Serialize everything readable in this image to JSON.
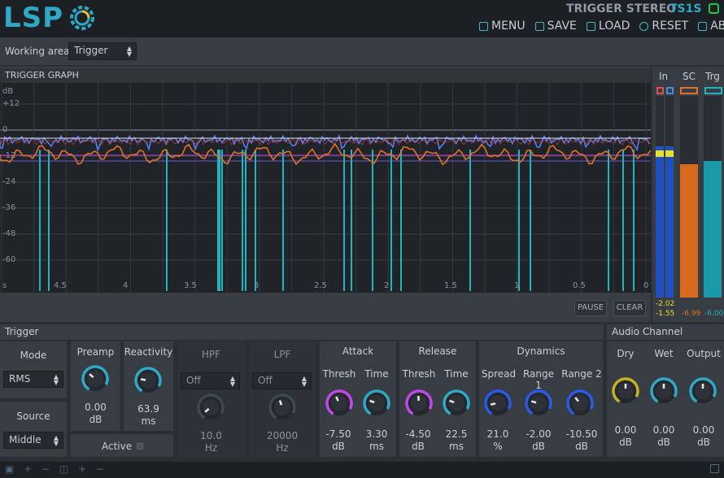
{
  "header": {
    "logo_text": "LSP",
    "plugin_name": "TRIGGER STEREO",
    "plugin_code": "TS1S",
    "menu": [
      {
        "label": "MENU",
        "icon": "menu-icon"
      },
      {
        "label": "SAVE",
        "icon": "save-icon"
      },
      {
        "label": "LOAD",
        "icon": "load-icon"
      },
      {
        "label": "RESET",
        "icon": "reset-icon"
      },
      {
        "label": "ABOUT",
        "icon": "about-icon"
      }
    ]
  },
  "working_area": {
    "label": "Working area",
    "value": "Trigger"
  },
  "graph": {
    "title": "TRIGGER GRAPH",
    "y_labels": [
      "dB",
      "+12",
      "0",
      "-12",
      "-24",
      "-36",
      "-48",
      "-60"
    ],
    "x_labels": [
      "s",
      "4.5",
      "4",
      "3.5",
      "3",
      "2.5",
      "2",
      "1.5",
      "1",
      "0.5",
      "0"
    ],
    "pause_label": "PAUSE",
    "clear_label": "CLEAR"
  },
  "meters": {
    "in": {
      "label": "In",
      "val1": "-2.02",
      "val2": "-1.55"
    },
    "sc": {
      "label": "SC",
      "val": "-6.99"
    },
    "trg": {
      "label": "Trg",
      "val": "-6.00"
    }
  },
  "trigger": {
    "title": "Trigger",
    "mode": {
      "label": "Mode",
      "value": "RMS"
    },
    "source": {
      "label": "Source",
      "value": "Middle"
    },
    "preamp": {
      "label": "Preamp",
      "value": "0.00",
      "unit": "dB"
    },
    "reactivity": {
      "label": "Reactivity",
      "value": "63.9",
      "unit": "ms"
    },
    "active": {
      "label": "Active"
    },
    "hpf": {
      "label": "HPF",
      "mode": "Off",
      "value": "10.0",
      "unit": "Hz"
    },
    "lpf": {
      "label": "LPF",
      "mode": "Off",
      "value": "20000",
      "unit": "Hz"
    },
    "attack": {
      "label": "Attack",
      "thresh_label": "Thresh",
      "time_label": "Time",
      "thresh": "-7.50",
      "thresh_unit": "dB",
      "time": "3.30",
      "time_unit": "ms"
    },
    "release": {
      "label": "Release",
      "thresh_label": "Thresh",
      "time_label": "Time",
      "thresh": "-4.50",
      "thresh_unit": "dB",
      "time": "22.5",
      "time_unit": "ms"
    },
    "dynamics": {
      "label": "Dynamics",
      "spread_label": "Spread",
      "range1_label": "Range 1",
      "range2_label": "Range 2",
      "spread": "21.0",
      "spread_unit": "%",
      "range1": "-2.00",
      "range1_unit": "dB",
      "range2": "-10.50",
      "range2_unit": "dB"
    }
  },
  "audio_channel": {
    "title": "Audio Channel",
    "dry": {
      "label": "Dry",
      "value": "0.00",
      "unit": "dB"
    },
    "wet": {
      "label": "Wet",
      "value": "0.00",
      "unit": "dB"
    },
    "output": {
      "label": "Output",
      "value": "0.00",
      "unit": "dB"
    }
  },
  "colors": {
    "accent": "#4ab6c9",
    "trigger_line": "#1fb5c1",
    "in_curve": "#5a7cf0",
    "sc_curve": "#e0722a"
  }
}
